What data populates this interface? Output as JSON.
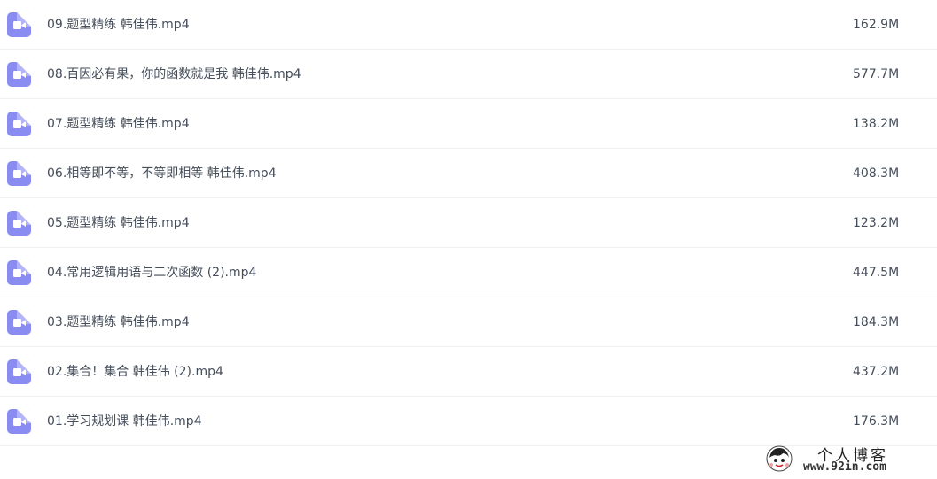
{
  "files": [
    {
      "name": "09.题型精练 韩佳伟.mp4",
      "size": "162.9M",
      "icon": "video-file-icon"
    },
    {
      "name": "08.百因必有果，你的函数就是我 韩佳伟.mp4",
      "size": "577.7M",
      "icon": "video-file-icon"
    },
    {
      "name": "07.题型精练 韩佳伟.mp4",
      "size": "138.2M",
      "icon": "video-file-icon"
    },
    {
      "name": "06.相等即不等，不等即相等 韩佳伟.mp4",
      "size": "408.3M",
      "icon": "video-file-icon"
    },
    {
      "name": "05.题型精练 韩佳伟.mp4",
      "size": "123.2M",
      "icon": "video-file-icon"
    },
    {
      "name": "04.常用逻辑用语与二次函数 (2).mp4",
      "size": "447.5M",
      "icon": "video-file-icon"
    },
    {
      "name": "03.题型精练 韩佳伟.mp4",
      "size": "184.3M",
      "icon": "video-file-icon"
    },
    {
      "name": "02.集合！集合 韩佳伟 (2).mp4",
      "size": "437.2M",
      "icon": "video-file-icon"
    },
    {
      "name": "01.学习规划课 韩佳伟.mp4",
      "size": "176.3M",
      "icon": "video-file-icon"
    }
  ],
  "watermark": {
    "title": "个人博客",
    "url": "www.92in.com"
  },
  "colors": {
    "icon_bg": "#8a8cf2",
    "text": "#454d5a",
    "divider": "#eef0f4"
  }
}
